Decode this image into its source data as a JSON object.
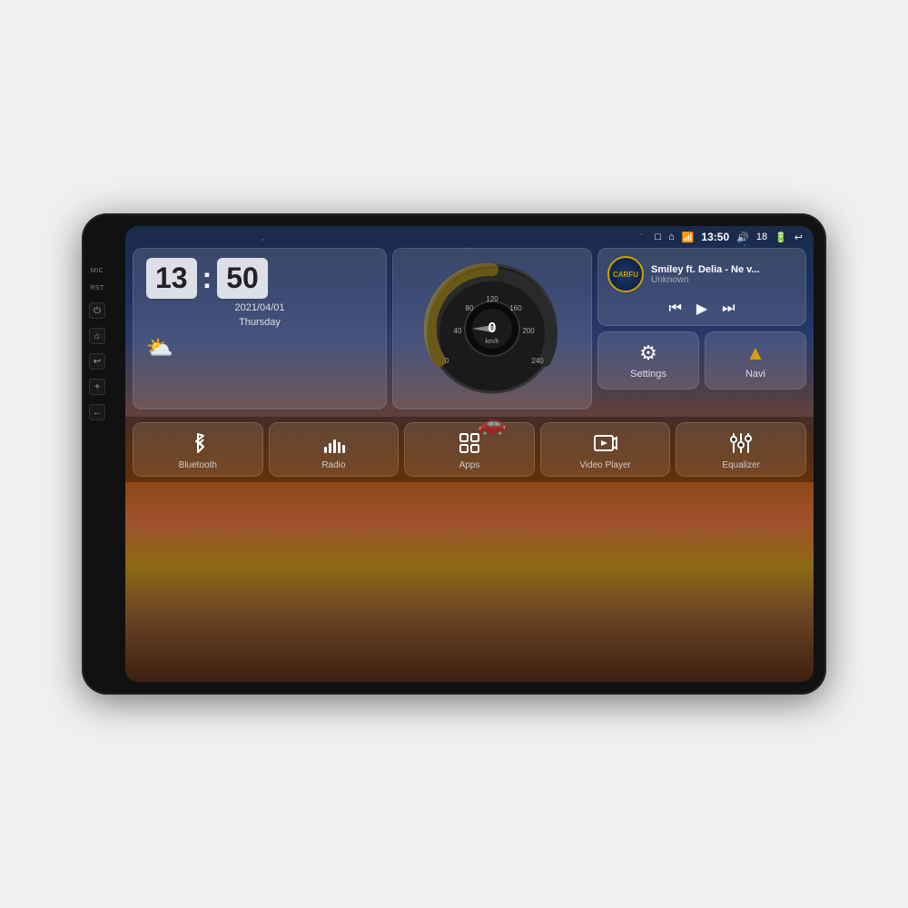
{
  "device": {
    "side_label_mic": "MIC",
    "side_label_rst": "RST"
  },
  "status_bar": {
    "wifi_icon": "▾",
    "time": "13:50",
    "volume_icon": "🔊",
    "volume_level": "18",
    "battery_icon": "▭",
    "back_icon": "↩",
    "home_icon": "⌂",
    "recents_icon": "□"
  },
  "clock": {
    "hours": "13",
    "minutes": "50",
    "date": "2021/04/01",
    "day": "Thursday"
  },
  "weather": {
    "icon": "⛅"
  },
  "speedometer": {
    "speed": "0",
    "unit": "km/h"
  },
  "music": {
    "logo": "CARFU",
    "title": "Smiley ft. Delia - Ne v...",
    "artist": "Unknown",
    "prev_icon": "⏮",
    "play_icon": "▶",
    "next_icon": "⏭"
  },
  "quick_actions": {
    "settings": {
      "label": "Settings",
      "icon": "⚙"
    },
    "navi": {
      "label": "Navi",
      "icon": "⬆"
    }
  },
  "bottom_bar": [
    {
      "id": "bluetooth",
      "label": "Bluetooth",
      "icon": "bluetooth"
    },
    {
      "id": "radio",
      "label": "Radio",
      "icon": "radio"
    },
    {
      "id": "apps",
      "label": "Apps",
      "icon": "apps"
    },
    {
      "id": "video-player",
      "label": "Video Player",
      "icon": "video"
    },
    {
      "id": "equalizer",
      "label": "Equalizer",
      "icon": "equalizer"
    }
  ]
}
